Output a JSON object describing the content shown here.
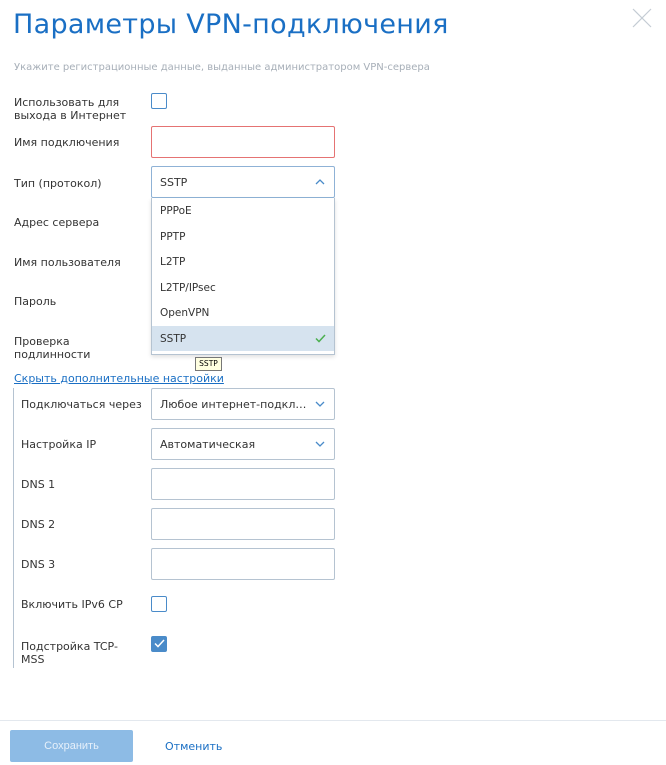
{
  "dialog": {
    "title": "Параметры VPN-подключения",
    "subtitle": "Укажите регистрационные данные, выданные администратором VPN-сервера"
  },
  "form": {
    "use_for_internet": {
      "label": "Использовать для выхода в Интернет",
      "checked": false
    },
    "connection_name": {
      "label": "Имя подключения",
      "value": ""
    },
    "type": {
      "label": "Тип (протокол)",
      "value": "SSTP",
      "options": [
        "PPPoE",
        "PPTP",
        "L2TP",
        "L2TP/IPsec",
        "OpenVPN",
        "SSTP"
      ],
      "selected_index": 5
    },
    "server_address": {
      "label": "Адрес сервера"
    },
    "username": {
      "label": "Имя пользователя"
    },
    "password": {
      "label": "Пароль"
    },
    "auth": {
      "label": "Проверка подлинности"
    },
    "tooltip": "SSTP"
  },
  "advanced": {
    "toggle_link": "Скрыть дополнительные настройки",
    "connect_via": {
      "label": "Подключаться через",
      "value": "Любое интернет-подключение"
    },
    "ip_setup": {
      "label": "Настройка IP",
      "value": "Автоматическая"
    },
    "dns1": {
      "label": "DNS 1",
      "value": ""
    },
    "dns2": {
      "label": "DNS 2",
      "value": ""
    },
    "dns3": {
      "label": "DNS 3",
      "value": ""
    },
    "ipv6cp": {
      "label": "Включить IPv6 CP",
      "checked": false
    },
    "tcp_mss": {
      "label": "Подстройка TCP-MSS",
      "checked": true
    }
  },
  "footer": {
    "save_label": "Сохранить",
    "cancel_label": "Отменить"
  },
  "colors": {
    "accent": "#1a6fc4",
    "checkbox": "#4a8bc9",
    "error_border": "#e57373",
    "selected_option": "#d6e3ef",
    "save_button": "#8dbbe5",
    "check_green": "#4caf50"
  }
}
